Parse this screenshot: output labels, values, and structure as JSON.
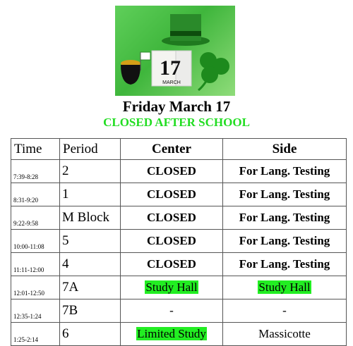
{
  "event": {
    "banner_month": "MARCH",
    "banner_day": "17",
    "title": "Friday March 17",
    "subtitle": "CLOSED AFTER SCHOOL"
  },
  "table": {
    "headers": [
      "Time",
      "Period",
      "Center",
      "Side"
    ],
    "rows": [
      {
        "time": "7:39-8:28",
        "period": "2",
        "center": "CLOSED",
        "side": "For Lang. Testing"
      },
      {
        "time": "8:31-9:20",
        "period": "1",
        "center": "CLOSED",
        "side": "For Lang. Testing"
      },
      {
        "time": "9:22-9:58",
        "period": "M Block",
        "center": "CLOSED",
        "side": "For Lang. Testing"
      },
      {
        "time": "10:00-11:08",
        "period": "5",
        "center": "CLOSED",
        "side": "For Lang. Testing"
      },
      {
        "time": "11:11-12:00",
        "period": "4",
        "center": "CLOSED",
        "side": "For Lang. Testing"
      },
      {
        "time": "12:01-12:50",
        "period": "7A",
        "center": "Study Hall",
        "side": "Study Hall"
      },
      {
        "time": "12:35-1:24",
        "period": "7B",
        "center": "-",
        "side": "-"
      },
      {
        "time": "1:25-2:14",
        "period": "6",
        "center": "Limited Study",
        "side": "Massicotte"
      }
    ]
  },
  "colors": {
    "highlight": "#22ee22",
    "subtitle": "#22dd22",
    "hat": "#2a8a2a"
  }
}
